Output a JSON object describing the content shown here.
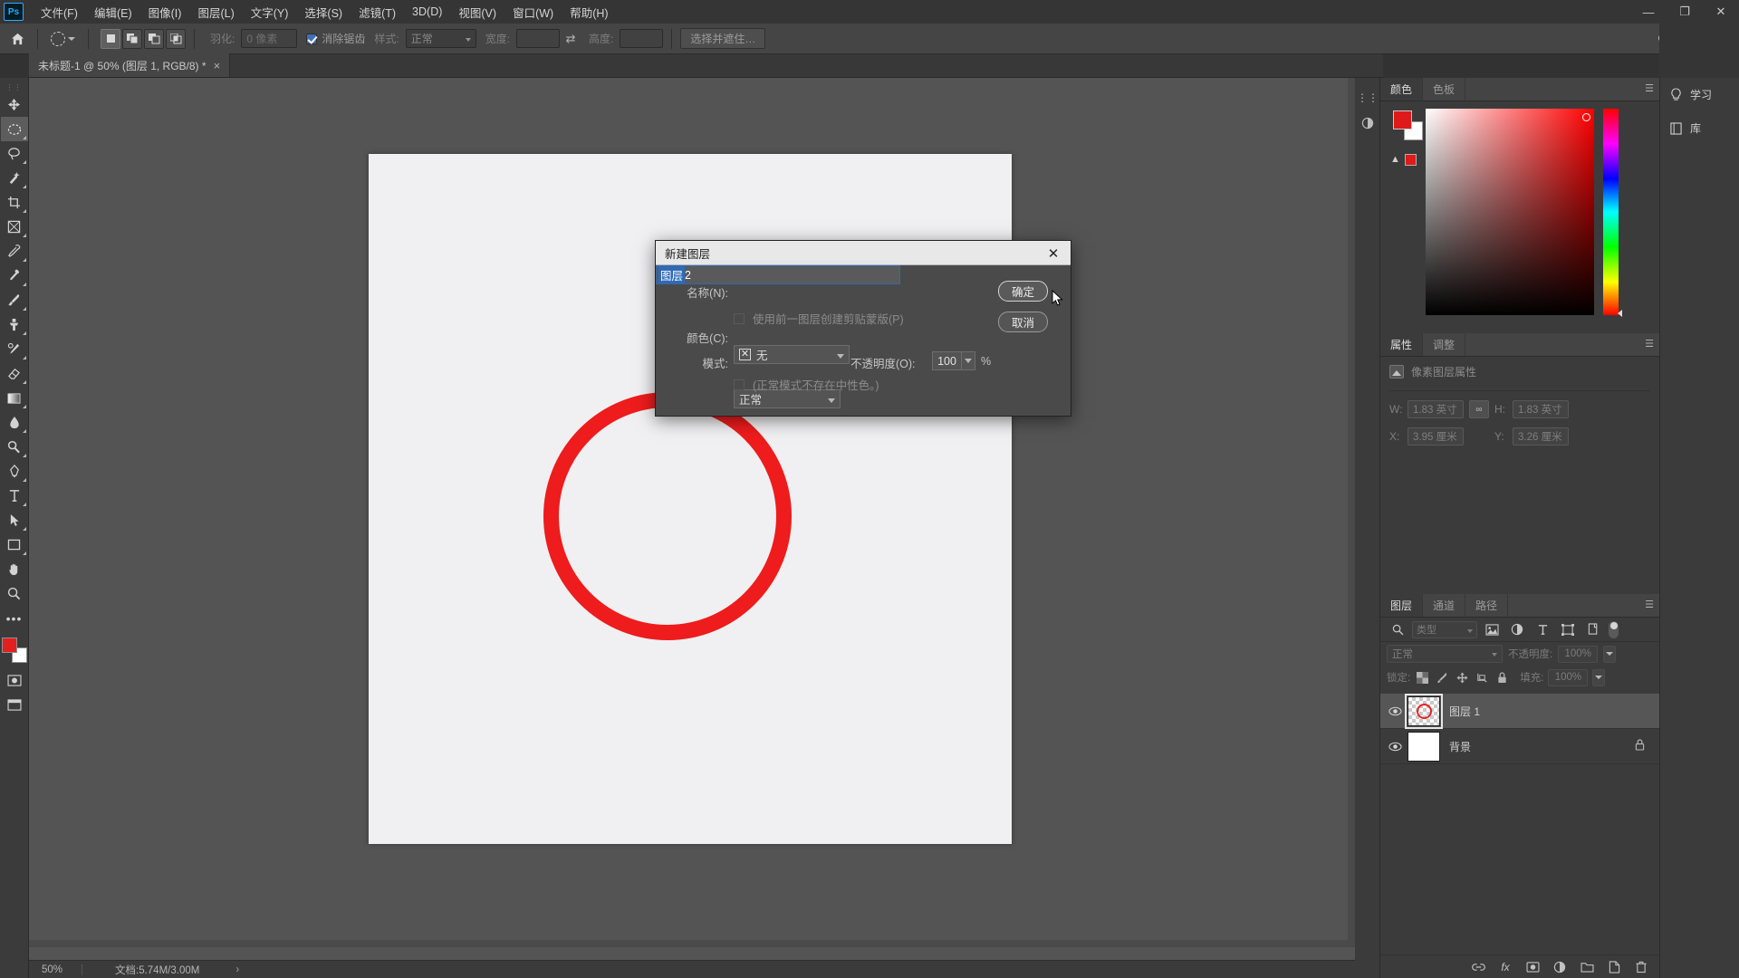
{
  "app": {
    "logo": "Ps"
  },
  "menubar": {
    "items": [
      "文件(F)",
      "编辑(E)",
      "图像(I)",
      "图层(L)",
      "文字(Y)",
      "选择(S)",
      "滤镜(T)",
      "3D(D)",
      "视图(V)",
      "窗口(W)",
      "帮助(H)"
    ],
    "window_controls": [
      "—",
      "❐",
      "✕"
    ]
  },
  "options_bar": {
    "home_icon": "home-icon",
    "tool_preset_icon": "elliptical-marquee-icon",
    "selection_modes": [
      "new-selection",
      "add-to-selection",
      "subtract-from-selection",
      "intersect-selection"
    ],
    "feather_label": "羽化:",
    "feather_value": "0 像素",
    "antialias_label": "消除锯齿",
    "antialias_checked": true,
    "style_label": "样式:",
    "style_value": "正常",
    "width_label": "宽度:",
    "width_value": "",
    "height_label": "高度:",
    "height_value": "",
    "swap_icon": "swap-icon",
    "refine_edge_label": "选择并遮住…",
    "right_icons": [
      "search-icon",
      "workspace-icon",
      "share-icon"
    ]
  },
  "document_tab": {
    "title": "未标题-1 @ 50% (图层 1, RGB/8) *",
    "close": "×"
  },
  "toolbar": {
    "tools": [
      {
        "name": "move-tool",
        "glyph": "move"
      },
      {
        "name": "elliptical-marquee-tool",
        "glyph": "ellipse",
        "active": true
      },
      {
        "name": "lasso-tool",
        "glyph": "lasso"
      },
      {
        "name": "quick-selection-tool",
        "glyph": "wand"
      },
      {
        "name": "crop-tool",
        "glyph": "crop"
      },
      {
        "name": "frame-tool",
        "glyph": "frame"
      },
      {
        "name": "eyedropper-tool",
        "glyph": "eyedropper"
      },
      {
        "name": "spot-healing-brush-tool",
        "glyph": "heal"
      },
      {
        "name": "brush-tool",
        "glyph": "brush"
      },
      {
        "name": "clone-stamp-tool",
        "glyph": "stamp"
      },
      {
        "name": "history-brush-tool",
        "glyph": "historybrush"
      },
      {
        "name": "eraser-tool",
        "glyph": "eraser"
      },
      {
        "name": "gradient-tool",
        "glyph": "gradient"
      },
      {
        "name": "blur-tool",
        "glyph": "blur"
      },
      {
        "name": "dodge-tool",
        "glyph": "dodge"
      },
      {
        "name": "pen-tool",
        "glyph": "pen"
      },
      {
        "name": "type-tool",
        "glyph": "type"
      },
      {
        "name": "path-selection-tool",
        "glyph": "pathselect"
      },
      {
        "name": "rectangle-tool",
        "glyph": "rect"
      },
      {
        "name": "hand-tool",
        "glyph": "hand"
      },
      {
        "name": "zoom-tool",
        "glyph": "zoom"
      },
      {
        "name": "more-tools",
        "glyph": "dots"
      },
      {
        "name": "edit-toolbar",
        "glyph": "edittoolbar"
      }
    ],
    "foreground_color": "#e41f1f",
    "background_color": "#ffffff",
    "extra": [
      "quick-mask-icon",
      "screen-mode-icon"
    ]
  },
  "canvas": {
    "zoom": "50%",
    "artboard_bg": "#f0eff1",
    "shape": {
      "name": "red-circle-outline",
      "color": "#ee1c1c"
    }
  },
  "status_bar": {
    "zoom": "50%",
    "doc_label": "文档:5.74M/3.00M",
    "arrow": "›"
  },
  "dialog": {
    "title": "新建图层",
    "close_glyph": "✕",
    "name_label": "名称(N):",
    "name_value_selected": "图层",
    "name_value_tail": " 2",
    "clipping_mask_label": "使用前一图层创建剪贴蒙版(P)",
    "clipping_mask_checked": false,
    "color_label": "颜色(C):",
    "color_value": "无",
    "color_swatch_glyph": "✕",
    "mode_label": "模式:",
    "mode_value": "正常",
    "opacity_label": "不透明度(O):",
    "opacity_value": "100",
    "opacity_unit": "%",
    "neutral_note": "(正常模式不存在中性色。)",
    "ok_label": "确定",
    "cancel_label": "取消"
  },
  "right_dock": {
    "color_panel": {
      "tabs": [
        "颜色",
        "色板"
      ],
      "active_tab": "颜色",
      "foreground": "#e01a1a",
      "background": "#ffffff",
      "warning_glyph": "▲"
    },
    "properties_panel": {
      "tabs": [
        "属性",
        "调整"
      ],
      "active_tab": "属性",
      "header": "像素图层属性",
      "fields": [
        {
          "label": "W:",
          "value": "1.83 英寸"
        },
        {
          "label": "H:",
          "value": "1.83 英寸"
        },
        {
          "label": "X:",
          "value": "3.95 厘米"
        },
        {
          "label": "Y:",
          "value": "3.26 厘米"
        }
      ],
      "link_icon": "link-icon"
    },
    "layers_panel": {
      "tabs": [
        "图层",
        "通道",
        "路径"
      ],
      "active_tab": "图层",
      "filter_placeholder": "类型",
      "filter_icons": [
        "image-filter-icon",
        "adjustment-filter-icon",
        "type-filter-icon",
        "shape-filter-icon",
        "smart-object-filter-icon"
      ],
      "blend_mode": "正常",
      "opacity_label": "不透明度:",
      "opacity_value": "100%",
      "lock_label": "锁定:",
      "lock_icons": [
        "lock-transparency-icon",
        "lock-image-icon",
        "lock-position-icon",
        "lock-artboard-icon",
        "lock-all-icon"
      ],
      "fill_label": "填充:",
      "fill_value": "100%",
      "layers": [
        {
          "name": "图层 1",
          "visible": true,
          "selected": true,
          "locked": false,
          "thumb": "transparent-circle"
        },
        {
          "name": "背景",
          "visible": true,
          "selected": false,
          "locked": true,
          "thumb": "white"
        }
      ],
      "footer_icons": [
        "link-layers-icon",
        "fx-icon",
        "add-mask-icon",
        "adjustment-layer-icon",
        "new-group-icon",
        "new-layer-icon",
        "delete-layer-icon"
      ]
    }
  },
  "far_rail": {
    "items": [
      {
        "label": "学习",
        "icon": "lightbulb-icon"
      },
      {
        "label": "库",
        "icon": "library-icon"
      }
    ]
  },
  "rail_icons": [
    "color-rail-icon",
    "properties-rail-icon",
    "layers-rail-icon"
  ]
}
